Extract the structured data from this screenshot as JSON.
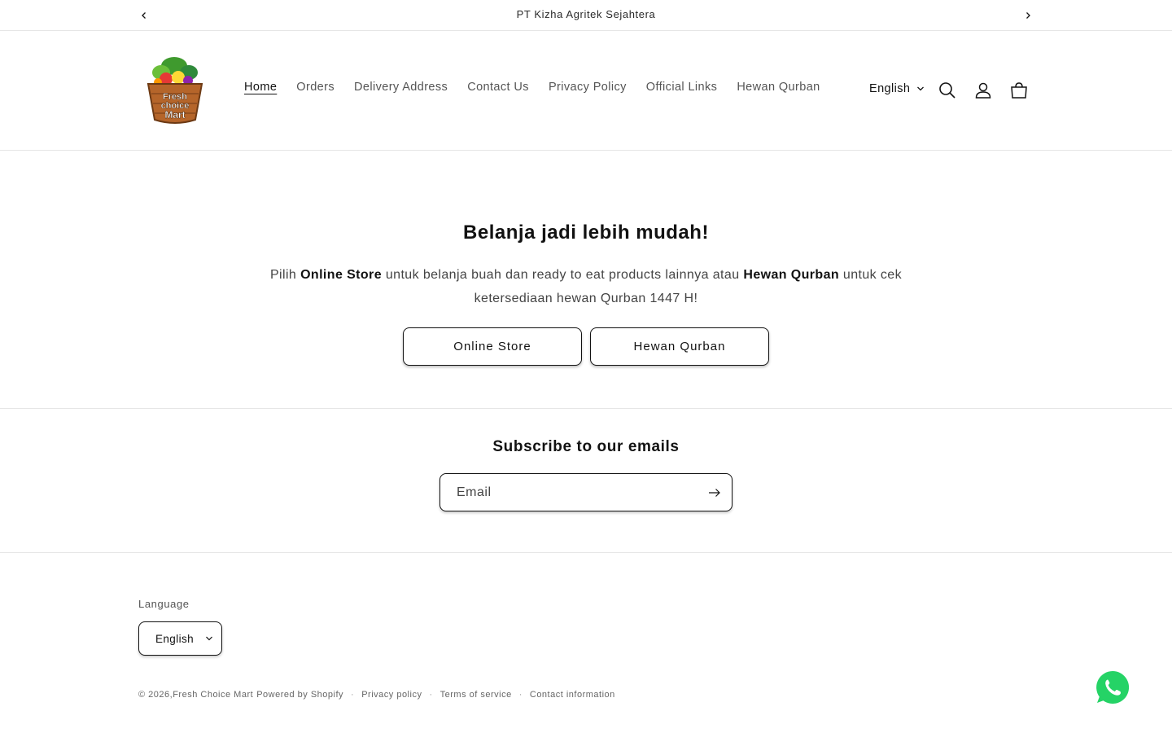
{
  "announcement": {
    "text": "PT Kizha Agritek Sejahtera",
    "prev_icon": "chevron-left-icon",
    "next_icon": "chevron-right-icon"
  },
  "header": {
    "logo_text": [
      "Fresh",
      "choice",
      "Mart"
    ],
    "nav": [
      "Home",
      "Orders",
      "Delivery Address",
      "Contact Us",
      "Privacy Policy",
      "Official Links",
      "Hewan Qurban"
    ],
    "active_nav": "Home",
    "language": "English",
    "icons": [
      "search-icon",
      "account-icon",
      "cart-icon"
    ]
  },
  "hero": {
    "title": "Belanja jadi lebih mudah!",
    "text_parts": [
      "Pilih ",
      "Online Store",
      " untuk belanja buah dan ready to eat products lainnya atau ",
      "Hewan Qurban",
      " untuk cek ketersediaan hewan Qurban 1447 H!"
    ],
    "buttons": [
      "Online Store",
      "Hewan Qurban"
    ]
  },
  "newsletter": {
    "title": "Subscribe to our emails",
    "email_placeholder": "Email",
    "email_value": "",
    "submit_icon": "arrow-right-icon"
  },
  "footer": {
    "language_label": "Language",
    "language_value": "English",
    "copyright_prefix": "© 2026, ",
    "store_name": "Fresh Choice Mart",
    "powered_by": "Powered by Shopify",
    "links": [
      "Privacy policy",
      "Terms of service",
      "Contact information"
    ]
  },
  "colors": {
    "text": "#121212",
    "muted": "#555555",
    "border": "#e6e6e6",
    "whatsapp": "#25d366"
  }
}
